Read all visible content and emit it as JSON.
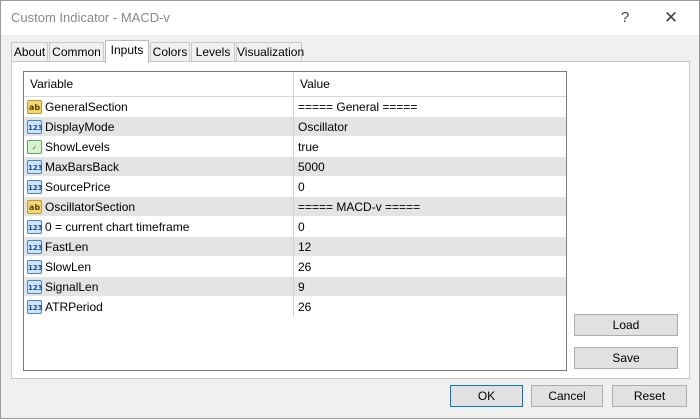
{
  "window": {
    "title": "Custom Indicator - MACD-v",
    "help_glyph": "?",
    "close_glyph": "✕"
  },
  "tabs": [
    "About",
    "Common",
    "Inputs",
    "Colors",
    "Levels",
    "Visualization"
  ],
  "active_tab": "Inputs",
  "grid": {
    "headers": {
      "variable": "Variable",
      "value": "Value"
    },
    "rows": [
      {
        "icon": "ab",
        "type": "text",
        "variable": "GeneralSection",
        "value": "===== General ====="
      },
      {
        "icon": "123",
        "type": "number",
        "variable": "DisplayMode",
        "value": "Oscillator"
      },
      {
        "icon": "bool",
        "type": "bool",
        "variable": "ShowLevels",
        "value": "true"
      },
      {
        "icon": "123",
        "type": "number",
        "variable": "MaxBarsBack",
        "value": "5000"
      },
      {
        "icon": "123",
        "type": "number",
        "variable": "SourcePrice",
        "value": "0"
      },
      {
        "icon": "ab",
        "type": "text",
        "variable": "OscillatorSection",
        "value": "===== MACD-v ====="
      },
      {
        "icon": "123",
        "type": "number",
        "variable": "0 = current chart timeframe",
        "value": "0"
      },
      {
        "icon": "123",
        "type": "number",
        "variable": "FastLen",
        "value": "12"
      },
      {
        "icon": "123",
        "type": "number",
        "variable": "SlowLen",
        "value": "26"
      },
      {
        "icon": "123",
        "type": "number",
        "variable": "SignalLen",
        "value": "9"
      },
      {
        "icon": "123",
        "type": "number",
        "variable": "ATRPeriod",
        "value": "26"
      }
    ]
  },
  "buttons": {
    "load": "Load",
    "save": "Save",
    "ok": "OK",
    "cancel": "Cancel",
    "reset": "Reset"
  }
}
